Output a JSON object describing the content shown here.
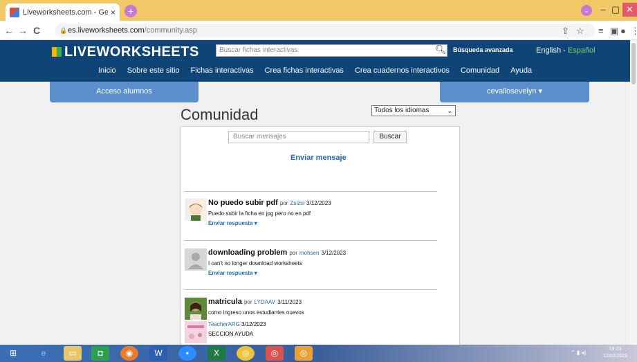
{
  "browser": {
    "tab_title": "Liveworksheets.com - Generado",
    "tab_close": "×",
    "new_tab": "+",
    "url_domain": "es.liveworksheets.com",
    "url_path": "/community.asp",
    "profile_dropdown": "⌄",
    "win_min": "–",
    "win_max": "▢",
    "win_close": "✕"
  },
  "site": {
    "logo": "LIVEWORKSHEETS",
    "search_placeholder": "Buscar fichas interactivas",
    "advanced_search": "Búsqueda avanzada",
    "lang_en": "English",
    "lang_sep": " - ",
    "lang_es": "Español",
    "nav": [
      "Inicio",
      "Sobre este sitio",
      "Fichas interactivas",
      "Crea fichas interactivas",
      "Crea cuadernos interactivos",
      "Comunidad",
      "Ayuda"
    ],
    "student_access": "Acceso alumnos",
    "user_menu": "cevallosevelyn ▾"
  },
  "main": {
    "title": "Comunidad",
    "language_select": "Todos los idiomas",
    "msg_search_placeholder": "Buscar mensajes",
    "msg_search_button": "Buscar",
    "send_message": "Enviar mensaje",
    "reply_label": "Enviar respuesta ▾",
    "posts": [
      {
        "title": "No puedo subir pdf",
        "by": "por",
        "user": "Zsizsi",
        "date": "3/12/2023",
        "body": "Puedo subir la ficha en jpg pero no en pdf"
      },
      {
        "title": "downloading problem",
        "by": "por",
        "user": "mohsen",
        "date": "3/12/2023",
        "body": "I can't no longer download worksheets"
      },
      {
        "title": "matricula",
        "by": "por",
        "user": "LYDAAV",
        "date": "3/11/2023",
        "body": "como ingreso unos estudiantes nuevos",
        "reply_user": "TeacherARG",
        "reply_date": "3/12/2023",
        "reply_body": "SECCION AYUDA"
      }
    ]
  },
  "taskbar": {
    "time": "19:23",
    "date": "12/03/2023"
  }
}
